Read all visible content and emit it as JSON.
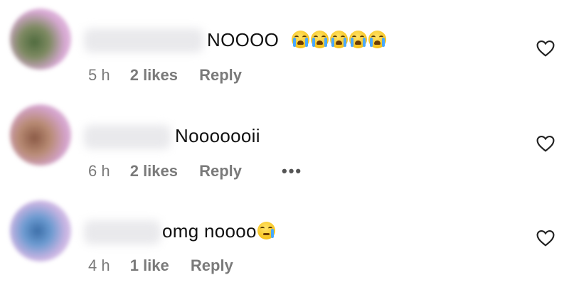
{
  "comments": [
    {
      "text": "NOOOO",
      "emojis": [
        "loudly-crying-face",
        "loudly-crying-face",
        "loudly-crying-face",
        "loudly-crying-face",
        "loudly-crying-face"
      ],
      "time": "5 h",
      "likes": "2 likes",
      "reply": "Reply",
      "more": ""
    },
    {
      "text": "Nooooooii",
      "emojis": [],
      "time": "6 h",
      "likes": "2 likes",
      "reply": "Reply",
      "more": "•••"
    },
    {
      "text": "omg noooo",
      "emojis": [
        "crying-face"
      ],
      "time": "4 h",
      "likes": "1 like",
      "reply": "Reply",
      "more": ""
    }
  ],
  "icons": {
    "like": "heart-outline-icon",
    "more": "more-options-icon"
  },
  "colors": {
    "text": "#111111",
    "meta": "#7a7a7a",
    "background": "#ffffff"
  }
}
